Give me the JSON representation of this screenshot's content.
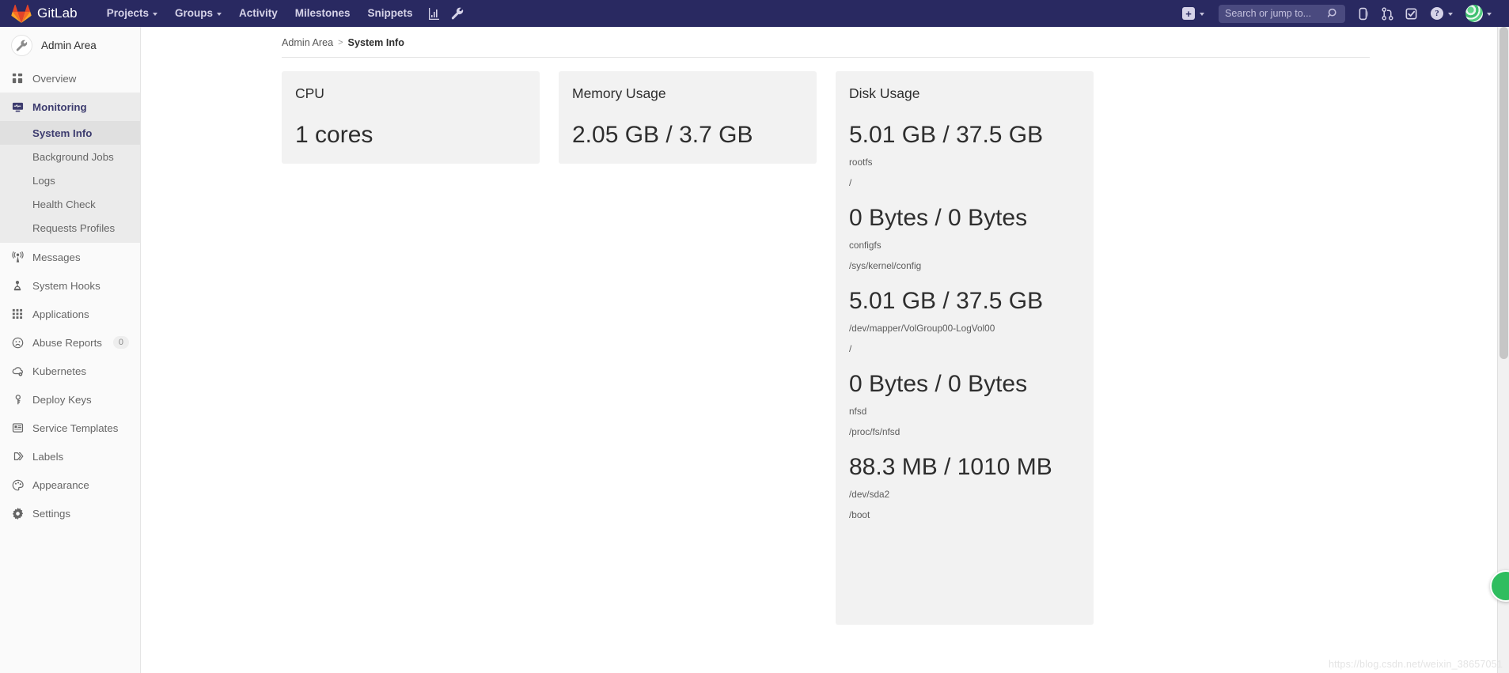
{
  "navbar": {
    "brand": "GitLab",
    "logo_icon": "gitlab-fox-logo",
    "items": [
      {
        "label": "Projects",
        "has_caret": true,
        "name": "nav-projects"
      },
      {
        "label": "Groups",
        "has_caret": true,
        "name": "nav-groups"
      },
      {
        "label": "Activity",
        "has_caret": false,
        "name": "nav-activity"
      },
      {
        "label": "Milestones",
        "has_caret": false,
        "name": "nav-milestones"
      },
      {
        "label": "Snippets",
        "has_caret": false,
        "name": "nav-snippets"
      }
    ],
    "icon_buttons": [
      {
        "icon": "chart-bar-icon",
        "name": "nav-analytics-icon"
      },
      {
        "icon": "wrench-icon",
        "name": "nav-admin-wrench-icon"
      }
    ],
    "new_dropdown": {
      "icon": "plus-square-icon",
      "label": "+"
    },
    "search": {
      "placeholder": "Search or jump to...",
      "value": "",
      "icon": "search-icon"
    },
    "right_icons": [
      {
        "icon": "issues-list-icon",
        "name": "nav-issues-icon"
      },
      {
        "icon": "merge-request-icon",
        "name": "nav-merge-requests-icon"
      },
      {
        "icon": "todos-check-icon",
        "name": "nav-todos-icon"
      }
    ],
    "help": {
      "icon": "question-circle-icon",
      "label": "?"
    },
    "user": {
      "avatar_icon": "user-avatar",
      "name": "user-menu"
    }
  },
  "sidebar": {
    "header": {
      "title": "Admin Area",
      "avatar_icon": "wrench-icon"
    },
    "items": [
      {
        "label": "Overview",
        "icon": "overview-grid-icon",
        "name": "sidebar-item-overview",
        "active": false,
        "badge": null
      },
      {
        "label": "Monitoring",
        "icon": "monitor-icon",
        "name": "sidebar-item-monitoring",
        "active": true,
        "badge": null
      },
      {
        "label": "Messages",
        "icon": "broadcast-icon",
        "name": "sidebar-item-messages",
        "active": false,
        "badge": null
      },
      {
        "label": "System Hooks",
        "icon": "hook-icon",
        "name": "sidebar-item-system-hooks",
        "active": false,
        "badge": null
      },
      {
        "label": "Applications",
        "icon": "applications-grid-icon",
        "name": "sidebar-item-applications",
        "active": false,
        "badge": null
      },
      {
        "label": "Abuse Reports",
        "icon": "abuse-face-icon",
        "name": "sidebar-item-abuse-reports",
        "active": false,
        "badge": "0"
      },
      {
        "label": "Kubernetes",
        "icon": "kubernetes-cloud-icon",
        "name": "sidebar-item-kubernetes",
        "active": false,
        "badge": null
      },
      {
        "label": "Deploy Keys",
        "icon": "key-icon",
        "name": "sidebar-item-deploy-keys",
        "active": false,
        "badge": null
      },
      {
        "label": "Service Templates",
        "icon": "template-icon",
        "name": "sidebar-item-service-templates",
        "active": false,
        "badge": null
      },
      {
        "label": "Labels",
        "icon": "labels-icon",
        "name": "sidebar-item-labels",
        "active": false,
        "badge": null
      },
      {
        "label": "Appearance",
        "icon": "palette-icon",
        "name": "sidebar-item-appearance",
        "active": false,
        "badge": null
      },
      {
        "label": "Settings",
        "icon": "gear-icon",
        "name": "sidebar-item-settings",
        "active": false,
        "badge": null
      }
    ],
    "monitoring_subitems": [
      {
        "label": "System Info",
        "name": "sidebar-subitem-system-info",
        "current": true
      },
      {
        "label": "Background Jobs",
        "name": "sidebar-subitem-background-jobs",
        "current": false
      },
      {
        "label": "Logs",
        "name": "sidebar-subitem-logs",
        "current": false
      },
      {
        "label": "Health Check",
        "name": "sidebar-subitem-health-check",
        "current": false
      },
      {
        "label": "Requests Profiles",
        "name": "sidebar-subitem-requests-profiles",
        "current": false
      }
    ]
  },
  "breadcrumb": {
    "root": "Admin Area",
    "separator": ">",
    "current": "System Info"
  },
  "cards": {
    "cpu": {
      "title": "CPU",
      "value": "1 cores"
    },
    "memory": {
      "title": "Memory Usage",
      "value": "2.05 GB / 3.7 GB"
    },
    "disk": {
      "title": "Disk Usage",
      "entries": [
        {
          "value": "5.01 GB / 37.5 GB",
          "device": "rootfs",
          "mount": "/"
        },
        {
          "value": "0 Bytes / 0 Bytes",
          "device": "configfs",
          "mount": "/sys/kernel/config"
        },
        {
          "value": "5.01 GB / 37.5 GB",
          "device": "/dev/mapper/VolGroup00-LogVol00",
          "mount": "/"
        },
        {
          "value": "0 Bytes / 0 Bytes",
          "device": "nfsd",
          "mount": "/proc/fs/nfsd"
        },
        {
          "value": "88.3 MB / 1010 MB",
          "device": "/dev/sda2",
          "mount": "/boot"
        }
      ]
    }
  },
  "watermark": {
    "text": "https://blog.csdn.net/weixin_38657051"
  },
  "colors": {
    "navbar_bg": "#292961",
    "sidebar_bg": "#fafafa",
    "card_bg": "#f2f2f2",
    "active_text": "#3c3b6e",
    "accent_green": "#2fbd5f"
  }
}
